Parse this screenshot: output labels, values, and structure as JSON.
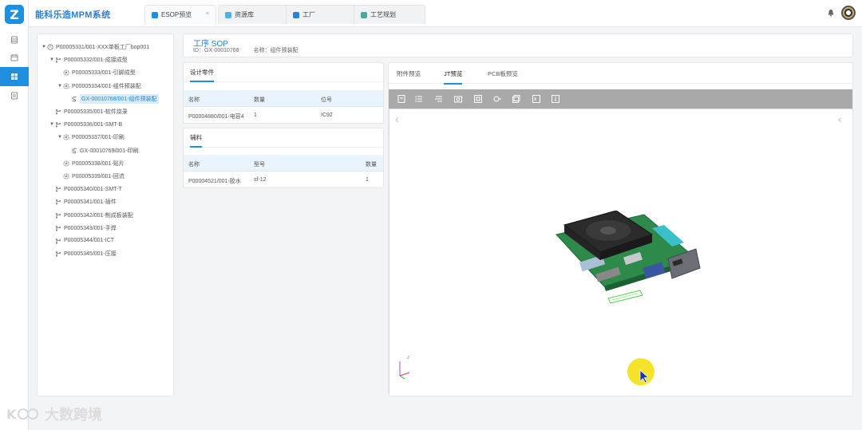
{
  "app": {
    "title": "能科乐造MPM系统",
    "logo_letter": "Z"
  },
  "rail": {
    "items": [
      "database-icon",
      "calendar-icon",
      "grid-icon",
      "document-icon"
    ],
    "active_index": 2,
    "active_color": "#1f8fe0"
  },
  "tabs": [
    {
      "label": "ESOP预览",
      "icon_color": "#1f8fe0",
      "closable": true,
      "close_glyph": "×"
    },
    {
      "label": "资源库",
      "icon_color": "#49b2e8",
      "closable": false
    },
    {
      "label": "工厂",
      "icon_color": "#2b7fd4",
      "closable": false
    },
    {
      "label": "工艺规划",
      "icon_color": "#4aa89a",
      "closable": false
    }
  ],
  "tree": {
    "nodes": [
      {
        "label": "P00005331/001-XXX单板工厂bop001",
        "level": 0,
        "arrow": "▼",
        "icon": "factory-icon"
      },
      {
        "label": "P00005332/001-成接成型",
        "level": 1,
        "arrow": "▼",
        "icon": "branch-icon"
      },
      {
        "label": "P00005333/001-引脚成型",
        "level": 2,
        "arrow": "",
        "icon": "gear-icon"
      },
      {
        "label": "P00005334/001-组件预装配",
        "level": 2,
        "arrow": "▼",
        "icon": "gear-icon"
      },
      {
        "label": "GX-00010768/001-组件预装配",
        "level": 3,
        "arrow": "",
        "icon": "process-icon",
        "selected": true
      },
      {
        "label": "P00005335/001-软件烧录",
        "level": 1,
        "arrow": "",
        "icon": "branch-icon"
      },
      {
        "label": "P00005336/001-SMT-B",
        "level": 1,
        "arrow": "▼",
        "icon": "branch-icon"
      },
      {
        "label": "P00005337/001-印刷",
        "level": 2,
        "arrow": "▼",
        "icon": "gear-icon"
      },
      {
        "label": "GX-00010769/001-印刷",
        "level": 3,
        "arrow": "",
        "icon": "process-icon"
      },
      {
        "label": "P00005338/001-贴片",
        "level": 2,
        "arrow": "",
        "icon": "gear-icon"
      },
      {
        "label": "P00005339/001-回流",
        "level": 2,
        "arrow": "",
        "icon": "gear-icon"
      },
      {
        "label": "P00005340/001-SMT-T",
        "level": 1,
        "arrow": "",
        "icon": "branch-icon"
      },
      {
        "label": "P00005341/001-插件",
        "level": 1,
        "arrow": "",
        "icon": "branch-icon"
      },
      {
        "label": "P00005342/001-制成板装配",
        "level": 1,
        "arrow": "",
        "icon": "branch-icon"
      },
      {
        "label": "P00005343/001-手焊",
        "level": 1,
        "arrow": "",
        "icon": "branch-icon"
      },
      {
        "label": "P00005344/001-ICT",
        "level": 1,
        "arrow": "",
        "icon": "branch-icon"
      },
      {
        "label": "P00005345/001-压接",
        "level": 1,
        "arrow": "",
        "icon": "branch-icon"
      }
    ]
  },
  "info": {
    "title": "工序 SOP",
    "id_text": "ID：GX-00010768",
    "name_text": "名称：组件预装配"
  },
  "design_parts": {
    "title": "设计零件",
    "headers": [
      "名称",
      "数量",
      "位号"
    ],
    "rows": [
      [
        "P00004880/001-电容4",
        "1",
        "IC92"
      ]
    ]
  },
  "auxiliary": {
    "title": "辅料",
    "headers": [
      "名称",
      "型号",
      "数量"
    ],
    "rows": [
      [
        "P00004521/001-胶水",
        "sf-12",
        "1"
      ]
    ]
  },
  "viewer": {
    "tabs": [
      "附件预览",
      "JT预览",
      "PCB板预览"
    ],
    "active_tab": 1,
    "toolbar_icons": [
      "fit-icon",
      "list-icon",
      "layers-icon",
      "camera-icon",
      "frame-icon",
      "settings-icon",
      "copy-icon",
      "terminal-icon",
      "info-icon"
    ],
    "nav_prev": "‹",
    "nav_next": "‹",
    "toolbar_color": "#a9a9a9",
    "axis_label": "Z"
  },
  "watermark": {
    "text": "大数跨境"
  }
}
